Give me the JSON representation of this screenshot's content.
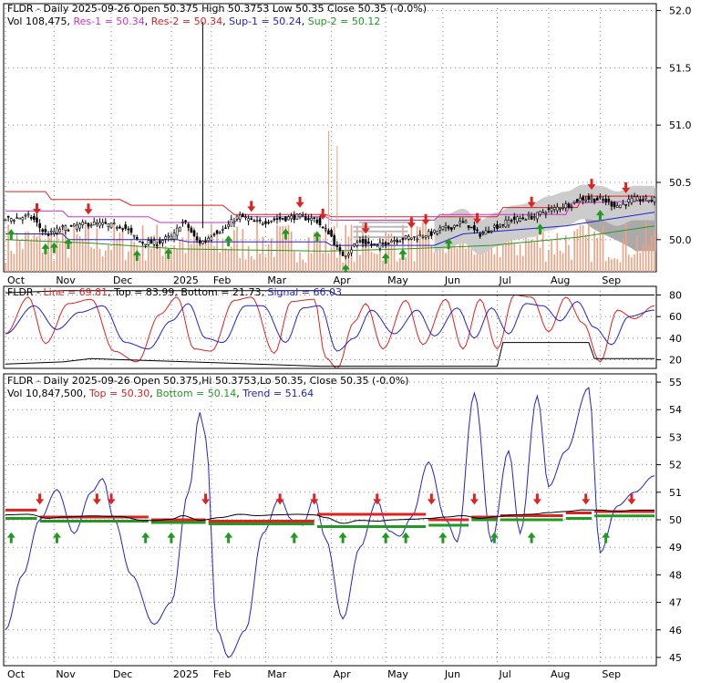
{
  "chart_data": [
    {
      "type": "candlestick",
      "panel": "price",
      "title": "FLDR - Daily 2025-09-26 Open 50.375  High 50.3753  Low 50.35  Close 50.35 (-0.0%)",
      "volume_text": "Vol 108,475",
      "levels": [
        {
          "name": "Res-1",
          "value": 50.34,
          "color": "#cc33cc"
        },
        {
          "name": "Res-2",
          "value": 50.34,
          "color": "#dd2222"
        },
        {
          "name": "Sup-1",
          "value": 50.24,
          "color": "#2222cc"
        },
        {
          "name": "Sup-2",
          "value": 50.12,
          "color": "#229922"
        }
      ],
      "yticks": [
        "52.0",
        "51.5",
        "51.0",
        "50.5",
        "50.0"
      ],
      "ylim": [
        49.72,
        52.06
      ],
      "xticks": [
        "Oct",
        "Nov",
        "Dec",
        "2025",
        "Feb",
        "Mar",
        "Apr",
        "May",
        "Jun",
        "Jul",
        "Aug",
        "Sep"
      ],
      "close_anchors": [
        [
          0,
          50.18
        ],
        [
          8,
          50.2
        ],
        [
          15,
          50.05
        ],
        [
          20,
          50.1
        ],
        [
          30,
          50.14
        ],
        [
          40,
          50.12
        ],
        [
          48,
          49.98
        ],
        [
          52,
          49.97
        ],
        [
          58,
          50.02
        ],
        [
          62,
          50.15
        ],
        [
          68,
          49.98
        ],
        [
          75,
          50.08
        ],
        [
          82,
          50.2
        ],
        [
          88,
          50.15
        ],
        [
          95,
          50.18
        ],
        [
          102,
          50.2
        ],
        [
          108,
          50.18
        ],
        [
          112,
          50.08
        ],
        [
          118,
          49.87
        ],
        [
          124,
          49.98
        ],
        [
          130,
          49.95
        ],
        [
          136,
          50.0
        ],
        [
          142,
          50.02
        ],
        [
          148,
          50.05
        ],
        [
          154,
          50.1
        ],
        [
          160,
          50.15
        ],
        [
          166,
          50.05
        ],
        [
          172,
          50.12
        ],
        [
          178,
          50.18
        ],
        [
          184,
          50.2
        ],
        [
          190,
          50.26
        ],
        [
          196,
          50.3
        ],
        [
          202,
          50.36
        ],
        [
          208,
          50.35
        ],
        [
          214,
          50.3
        ],
        [
          220,
          50.35
        ],
        [
          227,
          50.35
        ]
      ],
      "spikes": [
        [
          69,
          51.9
        ],
        [
          113,
          50.95
        ],
        [
          116,
          50.82
        ]
      ],
      "volume_profile_price_range": [
        49.9,
        50.45
      ]
    },
    {
      "type": "line",
      "panel": "oscillator",
      "title_prefix": "FLDR - ",
      "line_text": "Line = 69.81",
      "top_text": "Top = 83.99",
      "bottom_text": "Bottom = 21.73",
      "signal_text": "Signal = 66.03",
      "yticks": [
        "80",
        "60",
        "40",
        "20"
      ],
      "ylim": [
        12,
        88
      ],
      "series": [
        {
          "color": "#dd2222",
          "anchors": [
            [
              0,
              44
            ],
            [
              8,
              78
            ],
            [
              14,
              35
            ],
            [
              22,
              72
            ],
            [
              30,
              76
            ],
            [
              38,
              28
            ],
            [
              46,
              18
            ],
            [
              54,
              62
            ],
            [
              60,
              78
            ],
            [
              66,
              30
            ],
            [
              72,
              28
            ],
            [
              80,
              75
            ],
            [
              86,
              78
            ],
            [
              94,
              26
            ],
            [
              100,
              74
            ],
            [
              108,
              76
            ],
            [
              112,
              22
            ],
            [
              116,
              12
            ],
            [
              122,
              55
            ],
            [
              126,
              72
            ],
            [
              132,
              30
            ],
            [
              140,
              75
            ],
            [
              146,
              34
            ],
            [
              154,
              76
            ],
            [
              160,
              30
            ],
            [
              166,
              76
            ],
            [
              172,
              30
            ],
            [
              178,
              80
            ],
            [
              184,
              78
            ],
            [
              190,
              46
            ],
            [
              196,
              78
            ],
            [
              202,
              54
            ],
            [
              208,
              18
            ],
            [
              214,
              66
            ],
            [
              220,
              58
            ],
            [
              227,
              70
            ]
          ]
        },
        {
          "color": "#2222cc",
          "anchors": [
            [
              0,
              44
            ],
            [
              10,
              70
            ],
            [
              18,
              48
            ],
            [
              26,
              64
            ],
            [
              34,
              70
            ],
            [
              42,
              36
            ],
            [
              50,
              30
            ],
            [
              58,
              56
            ],
            [
              64,
              72
            ],
            [
              70,
              40
            ],
            [
              76,
              36
            ],
            [
              84,
              70
            ],
            [
              90,
              70
            ],
            [
              98,
              36
            ],
            [
              104,
              68
            ],
            [
              110,
              70
            ],
            [
              116,
              28
            ],
            [
              122,
              40
            ],
            [
              128,
              66
            ],
            [
              136,
              44
            ],
            [
              144,
              66
            ],
            [
              150,
              42
            ],
            [
              158,
              68
            ],
            [
              164,
              40
            ],
            [
              170,
              68
            ],
            [
              176,
              44
            ],
            [
              182,
              72
            ],
            [
              188,
              70
            ],
            [
              194,
              56
            ],
            [
              200,
              74
            ],
            [
              206,
              50
            ],
            [
              212,
              34
            ],
            [
              218,
              60
            ],
            [
              227,
              66
            ]
          ]
        },
        {
          "color": "#000000",
          "points": [
            [
              0,
              82
            ],
            [
              20,
              84
            ],
            [
              113,
              84
            ],
            [
              116,
              80
            ],
            [
              227,
              80
            ]
          ]
        },
        {
          "color": "#000000",
          "points": [
            [
              0,
              16
            ],
            [
              20,
              18
            ],
            [
              30,
              21
            ],
            [
              110,
              14
            ],
            [
              172,
              14
            ],
            [
              174,
              36
            ],
            [
              204,
              36
            ],
            [
              206,
              21
            ],
            [
              227,
              21
            ]
          ]
        }
      ]
    },
    {
      "type": "line",
      "panel": "cycle",
      "title": "FLDR - Daily 2025-09-26 Open 50.375,Hi 50.3753,Lo 50.35, Close 50.35 (-0.0%)",
      "volume_text": "Vol 10,847,500",
      "top_text": "Top = 50.30",
      "bottom_text": "Bottom = 50.14",
      "trend_text": "Trend = 51.64",
      "yticks": [
        "55",
        "54",
        "53",
        "52",
        "51",
        "50",
        "49",
        "48",
        "47",
        "46",
        "45"
      ],
      "ylim": [
        44.7,
        55.3
      ],
      "trend_anchors": [
        [
          0,
          46
        ],
        [
          6,
          48
        ],
        [
          12,
          50
        ],
        [
          18,
          51.1
        ],
        [
          24,
          49.5
        ],
        [
          30,
          51
        ],
        [
          34,
          51.5
        ],
        [
          38,
          50
        ],
        [
          44,
          48
        ],
        [
          52,
          46.2
        ],
        [
          58,
          47
        ],
        [
          64,
          51
        ],
        [
          68,
          53.9
        ],
        [
          70,
          53
        ],
        [
          74,
          46
        ],
        [
          78,
          45
        ],
        [
          84,
          46
        ],
        [
          90,
          49.5
        ],
        [
          96,
          50.8
        ],
        [
          100,
          50
        ],
        [
          104,
          49.8
        ],
        [
          108,
          50.8
        ],
        [
          112,
          49.3
        ],
        [
          118,
          46.4
        ],
        [
          124,
          49
        ],
        [
          130,
          50.7
        ],
        [
          134,
          49.6
        ],
        [
          138,
          49.4
        ],
        [
          142,
          50.1
        ],
        [
          148,
          52.1
        ],
        [
          154,
          50
        ],
        [
          158,
          49.2
        ],
        [
          164,
          54.6
        ],
        [
          170,
          49.2
        ],
        [
          176,
          52.5
        ],
        [
          180,
          49.5
        ],
        [
          186,
          54.5
        ],
        [
          190,
          51.2
        ],
        [
          196,
          52.5
        ],
        [
          204,
          54.8
        ],
        [
          208,
          48.8
        ],
        [
          214,
          50.5
        ],
        [
          220,
          51
        ],
        [
          227,
          51.6
        ]
      ],
      "top_segments": [
        [
          0,
          11,
          50.35
        ],
        [
          12,
          50,
          50.1
        ],
        [
          51,
          70,
          50.0
        ],
        [
          71,
          108,
          49.95
        ],
        [
          109,
          147,
          50.2
        ],
        [
          148,
          162,
          50.0
        ],
        [
          163,
          172,
          50.1
        ],
        [
          173,
          195,
          50.15
        ],
        [
          196,
          205,
          50.25
        ],
        [
          206,
          227,
          50.3
        ]
      ],
      "bottom_segments": [
        [
          0,
          11,
          50.05
        ],
        [
          12,
          50,
          49.95
        ],
        [
          51,
          70,
          49.9
        ],
        [
          71,
          108,
          49.85
        ],
        [
          109,
          147,
          49.75
        ],
        [
          148,
          162,
          49.8
        ],
        [
          163,
          172,
          50.0
        ],
        [
          173,
          195,
          50.0
        ],
        [
          196,
          205,
          50.05
        ],
        [
          206,
          227,
          50.14
        ]
      ]
    }
  ],
  "signals": {
    "price_up": [
      2,
      14,
      17,
      22,
      46,
      57,
      78,
      98,
      109,
      119,
      133,
      139,
      155,
      187,
      208
    ],
    "price_down": [
      11,
      29,
      86,
      103,
      111,
      126,
      142,
      147,
      165,
      184,
      205,
      217
    ],
    "cycle_up": [
      2,
      18,
      49,
      58,
      78,
      101,
      118,
      133,
      140,
      153,
      171,
      184,
      210
    ],
    "cycle_down": [
      12,
      32,
      37,
      70,
      96,
      108,
      130,
      149,
      164,
      186,
      203,
      219
    ]
  }
}
